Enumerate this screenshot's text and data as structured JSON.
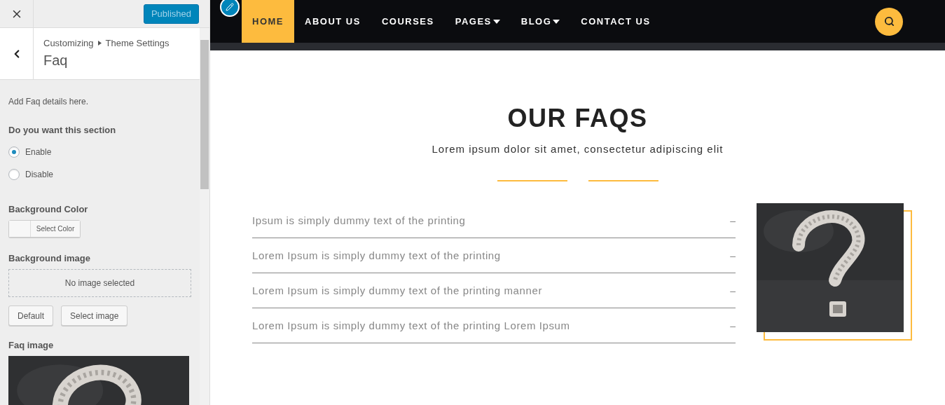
{
  "customizer": {
    "publish_button": "Published",
    "breadcrumb": [
      "Customizing",
      "Theme Settings"
    ],
    "section_title": "Faq",
    "description": "Add Faq details here.",
    "section_toggle": {
      "label": "Do you want this section",
      "options": [
        {
          "label": "Enable",
          "selected": true
        },
        {
          "label": "Disable",
          "selected": false
        }
      ]
    },
    "background_color": {
      "label": "Background Color",
      "button": "Select Color"
    },
    "background_image": {
      "label": "Background image",
      "placeholder": "No image selected",
      "buttons": [
        "Default",
        "Select image"
      ]
    },
    "faq_image": {
      "label": "Faq image",
      "kind": "picture"
    }
  },
  "preview": {
    "nav": [
      {
        "label": "HOME",
        "selected": true,
        "dropdown": false
      },
      {
        "label": "ABOUT US",
        "selected": false,
        "dropdown": false
      },
      {
        "label": "COURSES",
        "selected": false,
        "dropdown": false
      },
      {
        "label": "PAGES",
        "selected": false,
        "dropdown": true
      },
      {
        "label": "BLOG",
        "selected": false,
        "dropdown": true
      },
      {
        "label": "CONTACT US",
        "selected": false,
        "dropdown": false
      }
    ],
    "heading": "OUR FAQS",
    "subtitle": "Lorem ipsum dolor sit amet, consectetur adipiscing elit",
    "faqs": [
      {
        "question": "Ipsum is simply dummy text of the printing",
        "toggle": "–"
      },
      {
        "question": "Lorem Ipsum is simply dummy text of the printing",
        "toggle": "–"
      },
      {
        "question": "Lorem Ipsum is simply dummy text of the printing manner",
        "toggle": "–"
      },
      {
        "question": "Lorem Ipsum is simply dummy text of the printing Lorem Ipsum",
        "toggle": "–"
      }
    ]
  }
}
